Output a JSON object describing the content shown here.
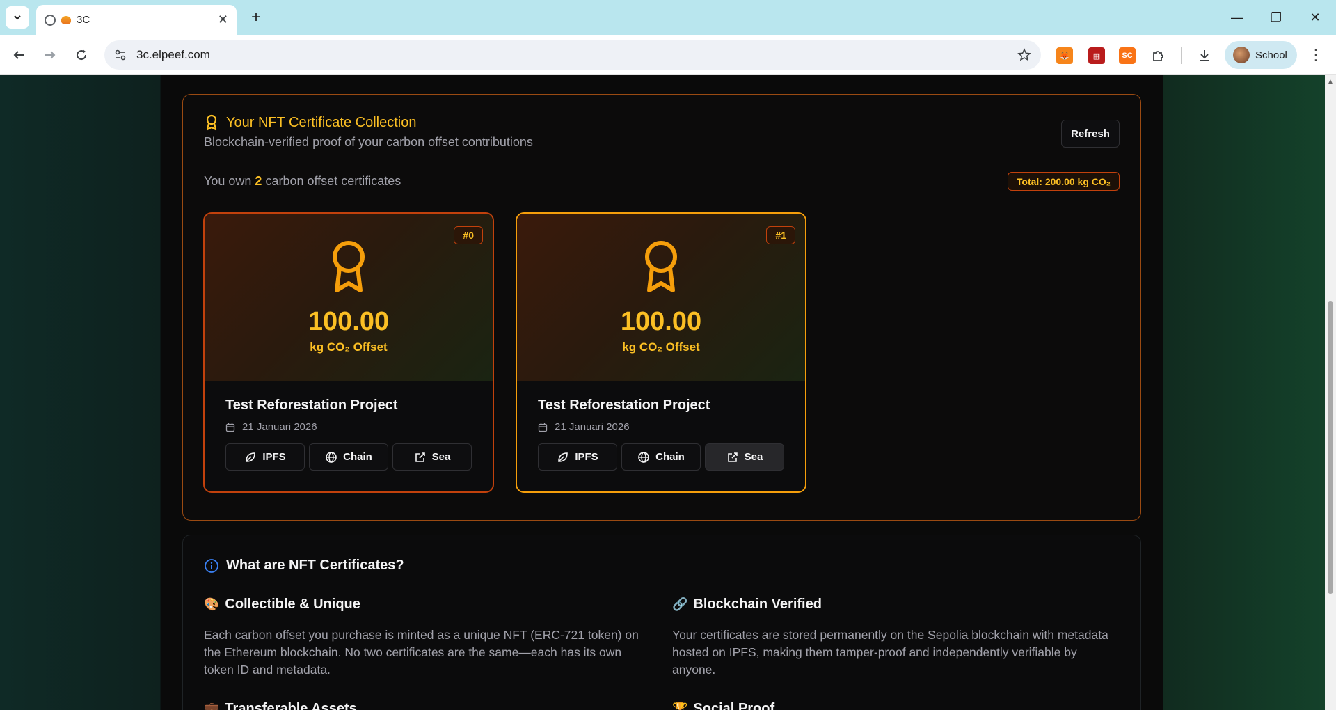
{
  "browser": {
    "tab_title": "3C",
    "url": "3c.elpeef.com",
    "profile_label": "School",
    "extensions": [
      {
        "name": "metamask-extension-icon",
        "label": ""
      },
      {
        "name": "red-extension-icon",
        "label": ""
      },
      {
        "name": "sc-extension-icon",
        "label": "SC"
      }
    ]
  },
  "collection": {
    "title": "Your NFT Certificate Collection",
    "subtitle": "Blockchain-verified proof of your carbon offset contributions",
    "refresh_label": "Refresh",
    "own_prefix": "You own",
    "own_count": "2",
    "own_suffix": "carbon offset certificates",
    "total_badge": "Total: 200.00 kg CO₂",
    "cards": [
      {
        "token": "#0",
        "amount": "100.00",
        "unit": "kg CO₂ Offset",
        "project": "Test Reforestation Project",
        "date": "21 Januari 2026",
        "buttons": [
          "IPFS",
          "Chain",
          "Sea"
        ]
      },
      {
        "token": "#1",
        "amount": "100.00",
        "unit": "kg CO₂ Offset",
        "project": "Test Reforestation Project",
        "date": "21 Januari 2026",
        "buttons": [
          "IPFS",
          "Chain",
          "Sea"
        ]
      }
    ]
  },
  "info": {
    "title": "What are NFT Certificates?",
    "features": [
      {
        "emoji": "🎨",
        "heading": "Collectible & Unique",
        "body": "Each carbon offset you purchase is minted as a unique NFT (ERC-721 token) on the Ethereum blockchain. No two certificates are the same—each has its own token ID and metadata."
      },
      {
        "emoji": "🔗",
        "heading": "Blockchain Verified",
        "body": "Your certificates are stored permanently on the Sepolia blockchain with metadata hosted on IPFS, making them tamper-proof and independently verifiable by anyone."
      },
      {
        "emoji": "💼",
        "heading": "Transferable Assets",
        "body": ""
      },
      {
        "emoji": "🏆",
        "heading": "Social Proof",
        "body": ""
      }
    ]
  },
  "colors": {
    "accent": "#fbbf24",
    "border": "#c2410c",
    "background": "#0a0a0a"
  }
}
